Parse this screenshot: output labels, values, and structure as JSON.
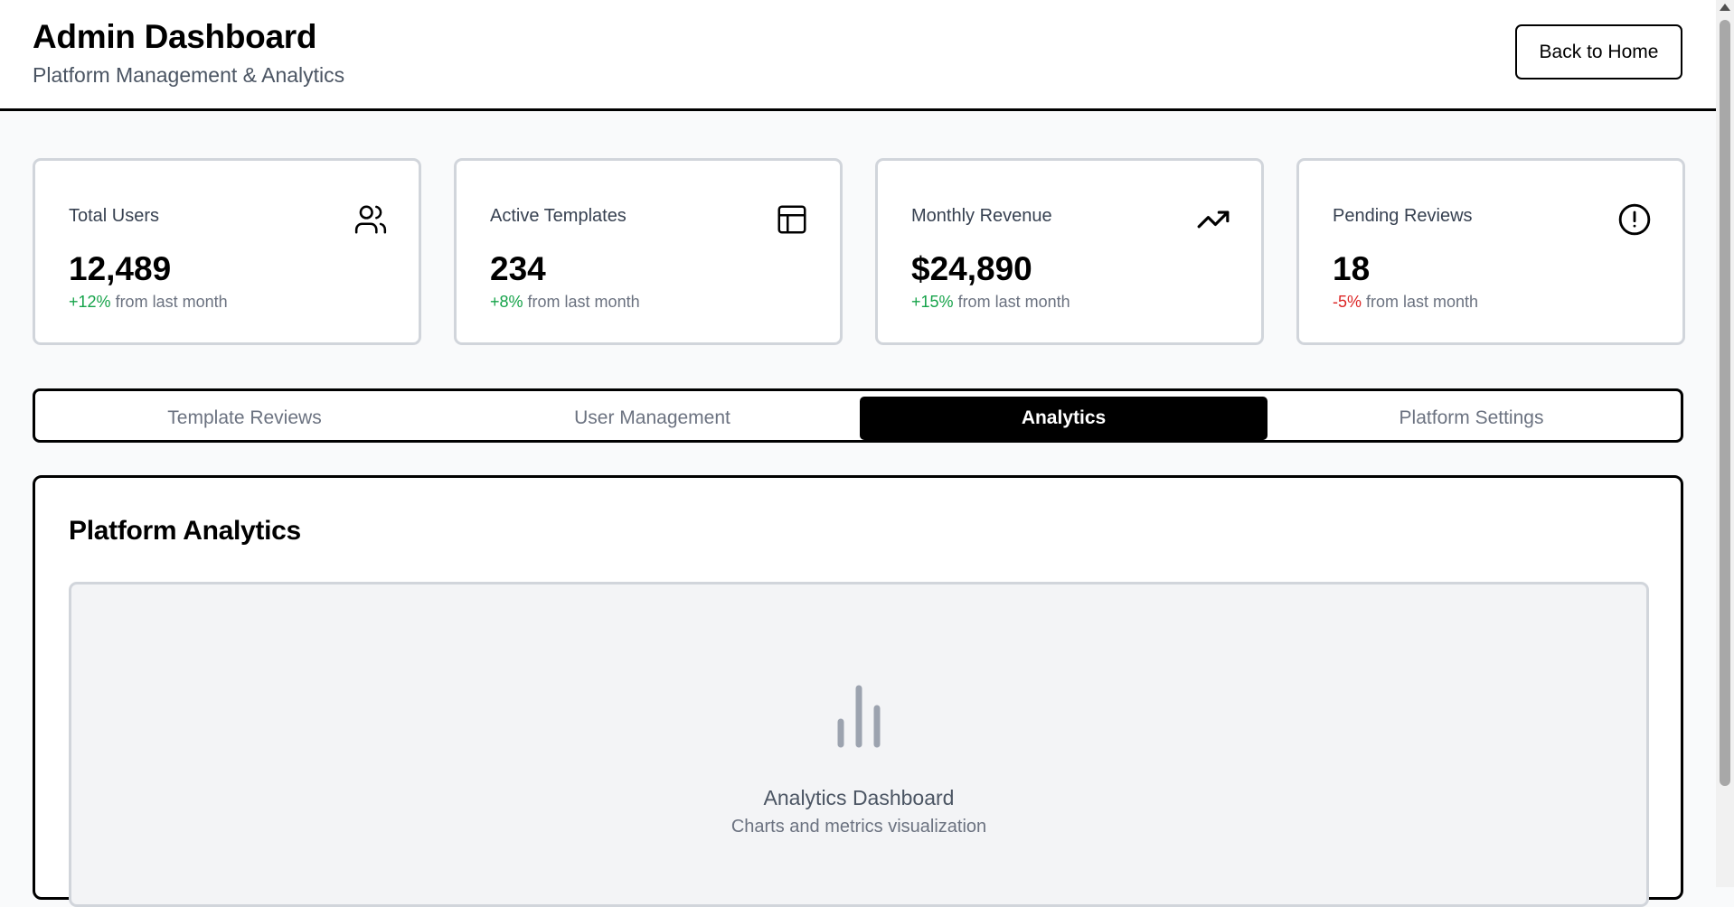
{
  "header": {
    "title": "Admin Dashboard",
    "subtitle": "Platform Management & Analytics",
    "back_button": "Back to Home"
  },
  "stats": [
    {
      "label": "Total Users",
      "value": "12,489",
      "change": "+12%",
      "change_suffix": "from last month",
      "trend": "positive",
      "icon": "users-icon"
    },
    {
      "label": "Active Templates",
      "value": "234",
      "change": "+8%",
      "change_suffix": "from last month",
      "trend": "positive",
      "icon": "layout-icon"
    },
    {
      "label": "Monthly Revenue",
      "value": "$24,890",
      "change": "+15%",
      "change_suffix": "from last month",
      "trend": "positive",
      "icon": "trending-up-icon"
    },
    {
      "label": "Pending Reviews",
      "value": "18",
      "change": "-5%",
      "change_suffix": "from last month",
      "trend": "negative",
      "icon": "alert-circle-icon"
    }
  ],
  "tabs": [
    {
      "label": "Template Reviews",
      "active": false
    },
    {
      "label": "User Management",
      "active": false
    },
    {
      "label": "Analytics",
      "active": true
    },
    {
      "label": "Platform Settings",
      "active": false
    }
  ],
  "panel": {
    "title": "Platform Analytics",
    "placeholder_icon": "bar-chart-icon",
    "placeholder_title": "Analytics Dashboard",
    "placeholder_subtitle": "Charts and metrics visualization"
  },
  "colors": {
    "positive": "#16a34a",
    "negative": "#dc2626",
    "active_tab_bg": "#000000",
    "page_bg": "#f9fafb"
  }
}
